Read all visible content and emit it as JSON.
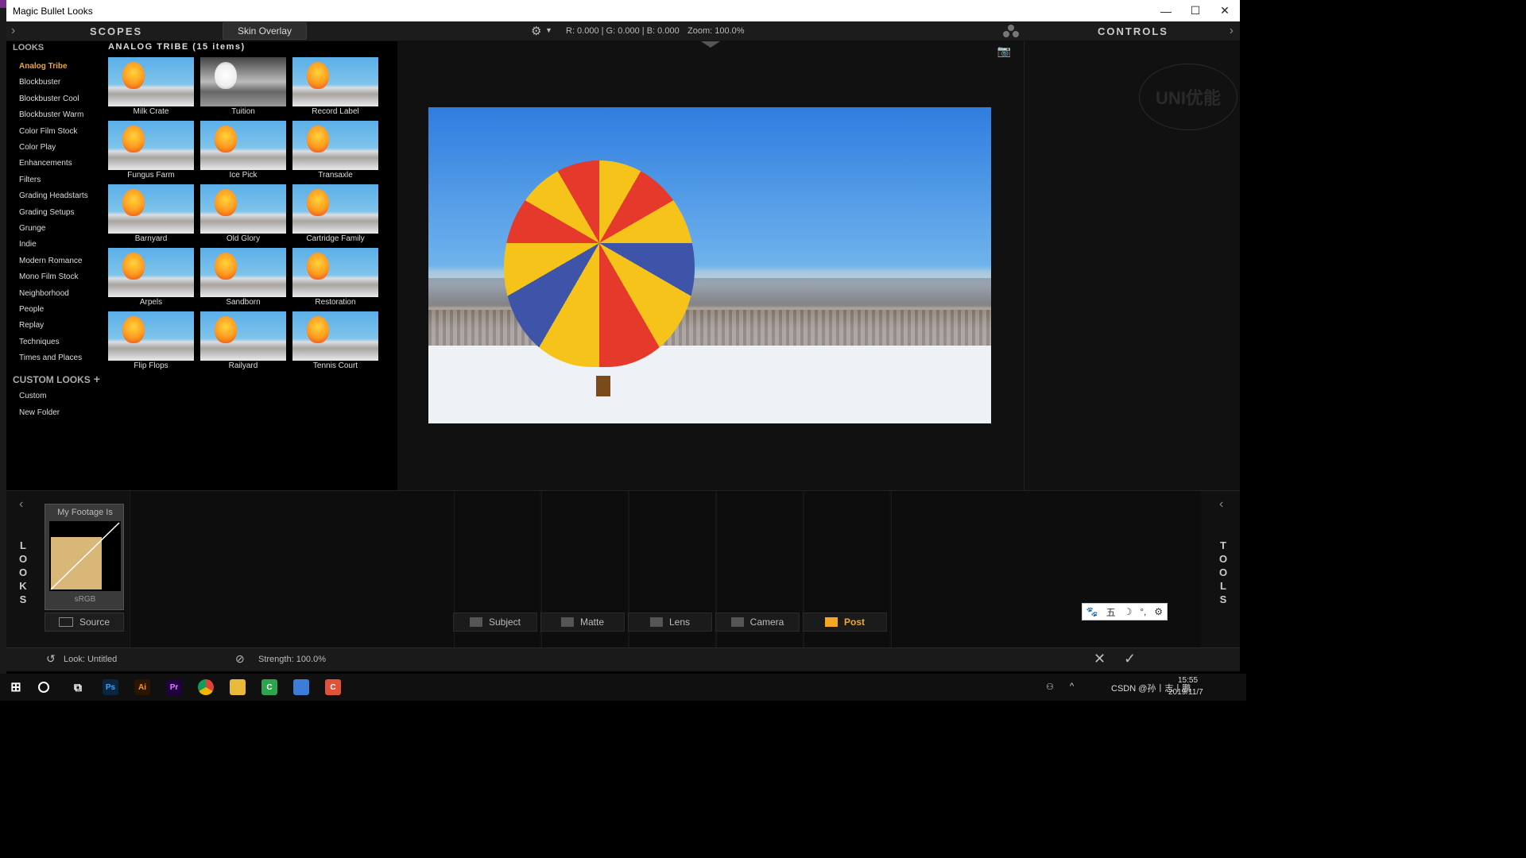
{
  "window": {
    "title": "Magic Bullet Looks"
  },
  "window_controls": {
    "minimize": "—",
    "maximize": "☐",
    "close": "✕"
  },
  "scopes": {
    "title": "SCOPES",
    "skin_overlay": "Skin Overlay",
    "readout": "R: 0.000 | G: 0.000 | B: 0.000",
    "zoom": "Zoom: 100.0%"
  },
  "controls": {
    "title": "CONTROLS"
  },
  "looks": {
    "heading": "LOOKS",
    "categories": [
      "Analog Tribe",
      "Blockbuster",
      "Blockbuster Cool",
      "Blockbuster Warm",
      "Color Film Stock",
      "Color Play",
      "Enhancements",
      "Filters",
      "Grading Headstarts",
      "Grading Setups",
      "Grunge",
      "Indie",
      "Modern Romance",
      "Mono Film Stock",
      "Neighborhood",
      "People",
      "Replay",
      "Techniques",
      "Times and Places"
    ],
    "active": "Analog Tribe",
    "custom_heading": "CUSTOM LOOKS",
    "custom_plus": "+",
    "custom_items": [
      "Custom",
      "New Folder"
    ]
  },
  "grid": {
    "title": "ANALOG TRIBE (15 items)",
    "items": [
      "Milk Crate",
      "Tuition",
      "Record Label",
      "Fungus Farm",
      "Ice Pick",
      "Transaxle",
      "Barnyard",
      "Old Glory",
      "Cartridge Family",
      "Arpels",
      "Sandborn",
      "Restoration",
      "Flip Flops",
      "Railyard",
      "Tennis Court"
    ]
  },
  "footage": {
    "title": "My Footage Is",
    "profile": "sRGB",
    "source_label": "Source"
  },
  "sides": {
    "left": [
      "L",
      "O",
      "O",
      "K",
      "S"
    ],
    "right": [
      "T",
      "O",
      "O",
      "L",
      "S"
    ]
  },
  "tools": {
    "tabs": [
      "Subject",
      "Matte",
      "Lens",
      "Camera",
      "Post"
    ],
    "active": "Post"
  },
  "status": {
    "look": "Look:  Untitled",
    "strength": "Strength:  100.0%",
    "cancel": "✕",
    "apply": "✓"
  },
  "taskbar": {
    "clock": "15:55",
    "date": "2019/11/7",
    "tray_text": "CSDN @孙丨志丨鹏",
    "ime": "五"
  },
  "watermark": "UNI优能",
  "colors": {
    "accent": "#f5a623",
    "bg": "#000000",
    "panel": "#1c1c1c"
  }
}
